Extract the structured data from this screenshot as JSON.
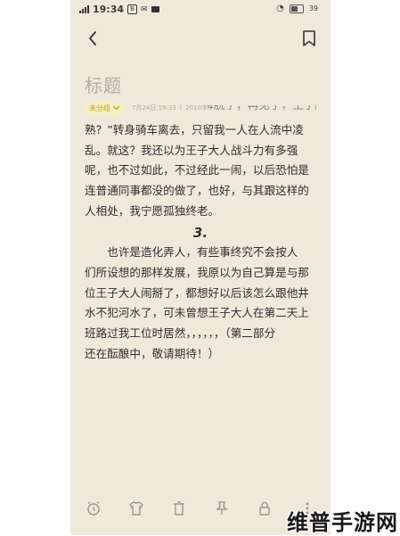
{
  "status_bar": {
    "time": "19:34",
    "battery": "39"
  },
  "note": {
    "title": "标题",
    "category": "未分组",
    "date": "7月24日 19:33",
    "separator": "|",
    "word_count": "2010字",
    "cut_line": "“—那么，我也终于可以解脱了，再见了，王子殿下……”",
    "paragraph1": [
      "熟？”转身骑车离去，只留我一人在人流中凌",
      "乱。就这？我还以为王子大人战斗力有多强",
      "呢，也不过如此，不过经此一闹，以后恐怕是",
      "连普通同事都没的做了，也好，与其跟这样的",
      "人相处，我宁愿孤独终老。"
    ],
    "section_heading": "3.",
    "paragraph2": [
      "也许是造化弄人，有些事终究不会按人",
      "们所设想的那样发展，我原以为自己算是与那",
      "位王子大人闹掰了，都想好以后该怎么跟他井",
      "水不犯河水了，可未曾想王子大人在第二天上",
      "班路过我工位时居然，，，，，，（第二部分",
      "还在酝酿中，敬请期待！）"
    ]
  },
  "toolbar": {
    "items": [
      "alarm-icon",
      "shirt-icon",
      "trash-icon",
      "pin-icon",
      "lock-icon",
      "more-icon"
    ]
  },
  "watermark": "维普手游网",
  "colors": {
    "paper": "#efe9dc",
    "accent": "#c9a21f",
    "text": "#2f2f2f",
    "muted": "#b3ada2"
  }
}
